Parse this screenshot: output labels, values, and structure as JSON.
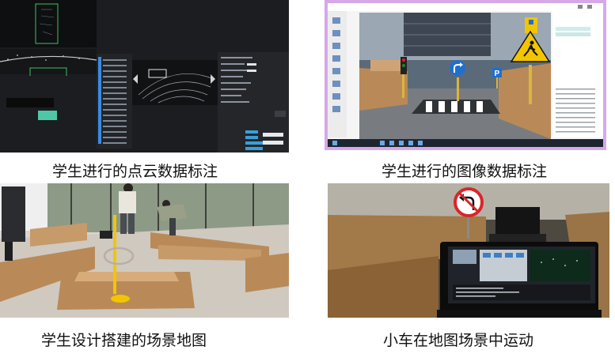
{
  "captions": {
    "top_left": "学生进行的点云数据标注",
    "top_right": "学生进行的图像数据标注",
    "bottom_left": "学生设计搭建的场景地图",
    "bottom_right": "小车在地图场景中运动"
  },
  "colors": {
    "pointcloud_bg": "#1b1d20",
    "annotation_green": "#35c27a",
    "window_border": "#d6a8e8",
    "cardboard": "#b98a57",
    "sign_yellow": "#f2c500",
    "sign_blue": "#1f6fd1",
    "sign_red": "#d7262b",
    "floor_gray": "#d9d6d1"
  },
  "icons": {
    "no_left_turn": "no-left-turn-sign-icon",
    "pedestrian": "pedestrian-crossing-sign-icon",
    "parking": "parking-sign-icon",
    "turn_right": "turn-right-sign-icon"
  }
}
